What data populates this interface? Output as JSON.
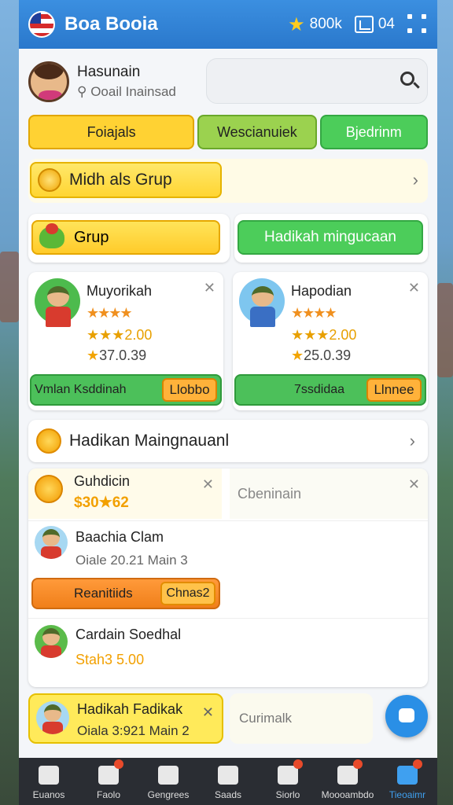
{
  "header": {
    "title": "Boa Booia",
    "stars": "800k",
    "boxes": "04"
  },
  "profile": {
    "name": "Hasunain",
    "subtitle": "Ooail Inainsad"
  },
  "tabs": [
    "Foiajals",
    "Wescianuiek",
    "Bjedrinm"
  ],
  "banner": {
    "label": "Midh als Grup"
  },
  "grup": {
    "label": "Grup",
    "green_button": "Hadikah mingucaan"
  },
  "products": [
    {
      "title": "Muyorikah",
      "stars": "★★★★",
      "rating": "★★★2.00",
      "price": "37.0.39",
      "action": "Vmlan Ksddinah",
      "button": "Llobbo"
    },
    {
      "title": "Hapodian",
      "stars": "★★★★",
      "rating": "★★★2.00",
      "price": "25.0.39",
      "action": "7ssdidaa",
      "button": "Llnnee"
    }
  ],
  "section": {
    "title": "Hadikan Maingnauanl"
  },
  "list": {
    "row1": {
      "title": "Guhdicin",
      "price": "$30★62",
      "placeholder": "Cbeninain"
    },
    "row2": {
      "title": "Baachia Clam",
      "sub": "Oiale 20.21 Main 3",
      "button": "Reanitiids",
      "button_inner": "Chnas2"
    },
    "row3": {
      "title": "Cardain Soedhal",
      "stat": "Stah3 5.00"
    }
  },
  "bottom": {
    "title": "Hadikah Fadikak",
    "sub": "Oiala 3:921 Main 2",
    "placeholder": "Curimalk"
  },
  "nav": [
    "Euanos",
    "Faolo",
    "Gengrees",
    "Saads",
    "Siorlo",
    "Moooambdo",
    "Tieoaimr"
  ]
}
